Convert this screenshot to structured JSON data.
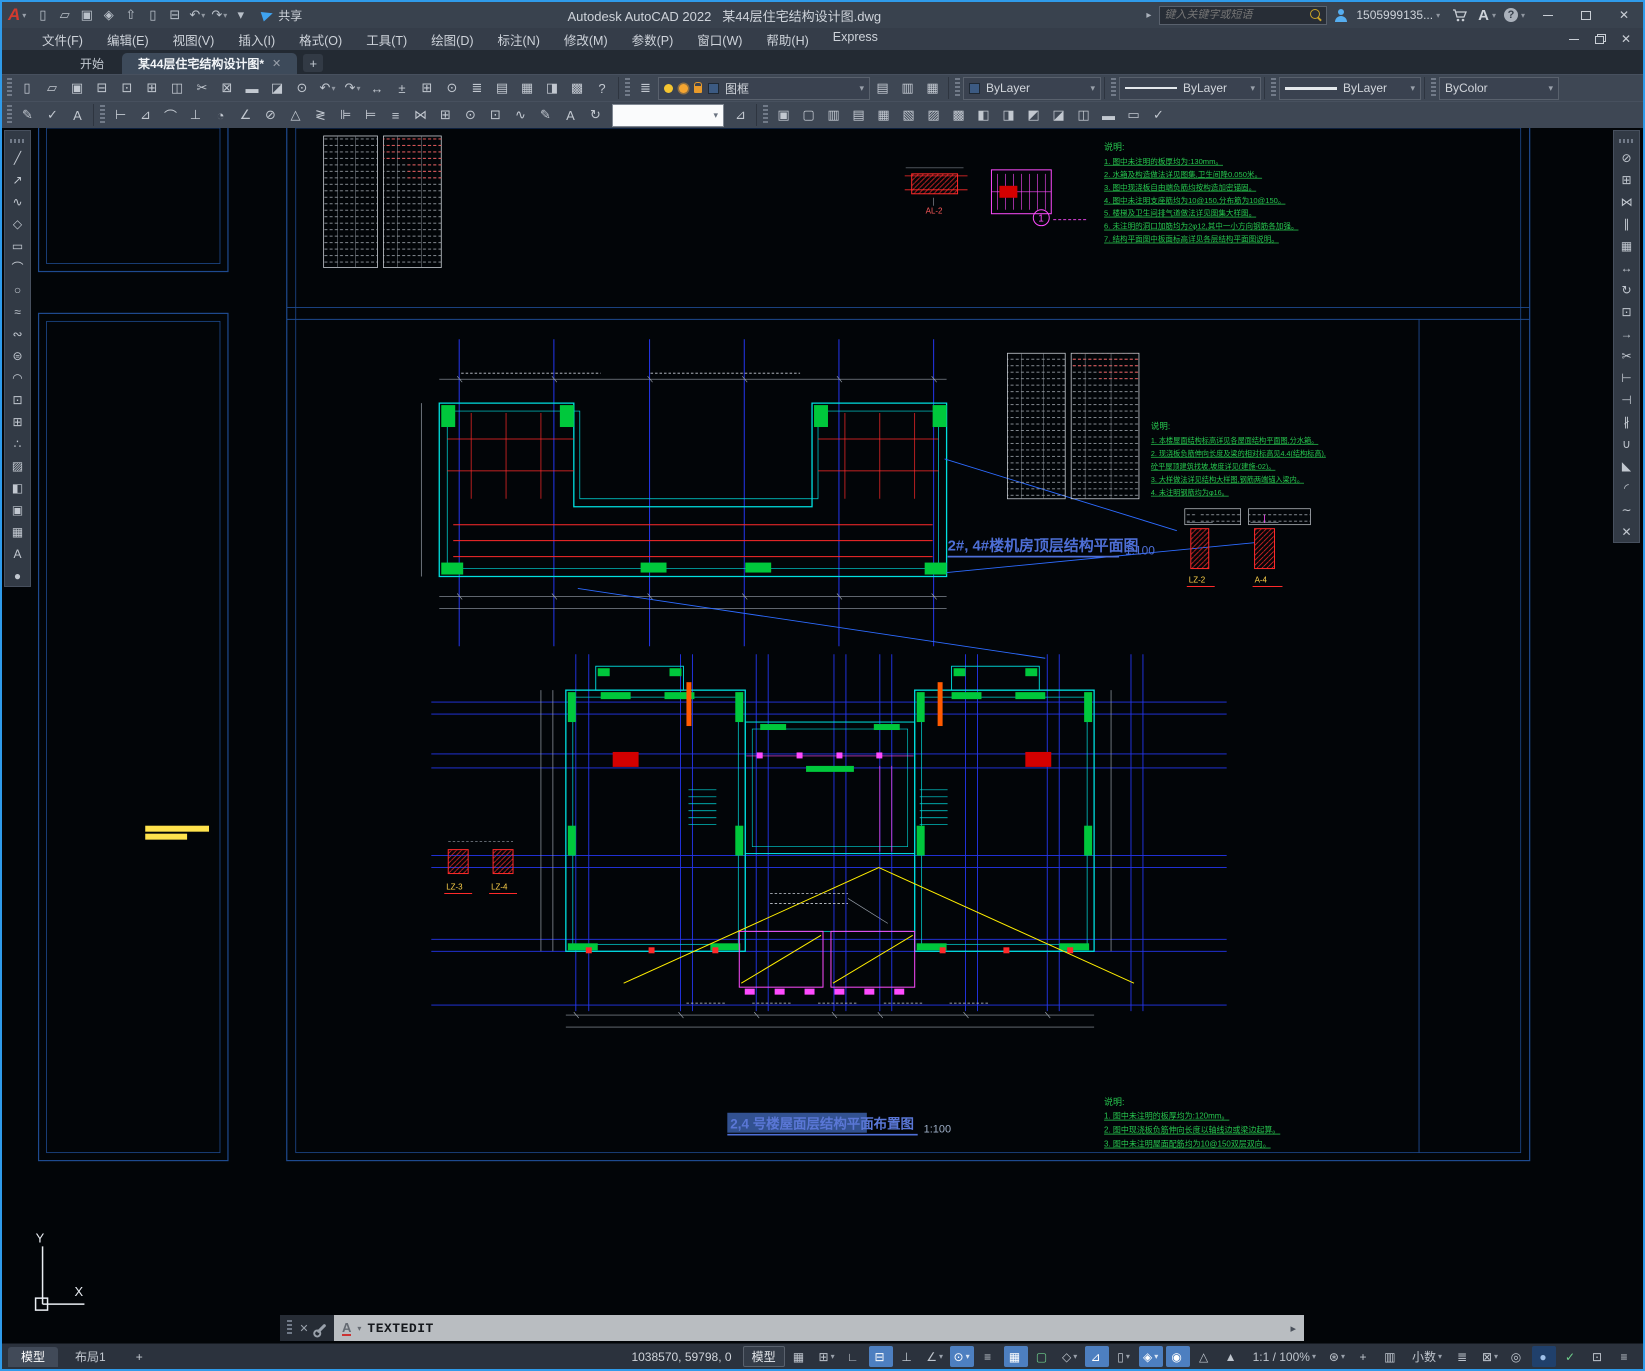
{
  "window": {
    "app_title": "Autodesk AutoCAD 2022",
    "doc_title": "某44层住宅结构设计图.dwg",
    "share_label": "共享",
    "search_placeholder": "键入关键字或短语",
    "account": "1505999135...",
    "start_tab": "开始",
    "doc_tab": "某44层住宅结构设计图*",
    "close_glyph": "✕",
    "new_tab_glyph": "+",
    "collapse_glyph": "▸",
    "help_glyph": "?",
    "autodesk_glyph": "A"
  },
  "menus": [
    {
      "n": "menu-file",
      "l": "文件(F)"
    },
    {
      "n": "menu-edit",
      "l": "编辑(E)"
    },
    {
      "n": "menu-view",
      "l": "视图(V)"
    },
    {
      "n": "menu-insert",
      "l": "插入(I)"
    },
    {
      "n": "menu-format",
      "l": "格式(O)"
    },
    {
      "n": "menu-tools",
      "l": "工具(T)"
    },
    {
      "n": "menu-draw",
      "l": "绘图(D)"
    },
    {
      "n": "menu-dimension",
      "l": "标注(N)"
    },
    {
      "n": "menu-modify",
      "l": "修改(M)"
    },
    {
      "n": "menu-parametric",
      "l": "参数(P)"
    },
    {
      "n": "menu-window",
      "l": "窗口(W)"
    },
    {
      "n": "menu-help",
      "l": "帮助(H)"
    },
    {
      "n": "menu-express",
      "l": "Express"
    }
  ],
  "qat": [
    {
      "n": "qat-new-icon",
      "g": "▯"
    },
    {
      "n": "qat-open-icon",
      "g": "▱"
    },
    {
      "n": "qat-save-icon",
      "g": "▣"
    },
    {
      "n": "qat-save-as-icon",
      "g": "◈"
    },
    {
      "n": "qat-upload-mobile-icon",
      "g": "⇧"
    },
    {
      "n": "qat-open-mobile-icon",
      "g": "▯"
    },
    {
      "n": "qat-plot-icon",
      "g": "⊟"
    },
    {
      "n": "qat-undo-icon",
      "g": "↶",
      "cv": "▾"
    },
    {
      "n": "qat-redo-icon",
      "g": "↷",
      "cv": "▾"
    },
    {
      "n": "qat-customize-icon",
      "g": "▾"
    }
  ],
  "toolbar1": {
    "icons": [
      {
        "n": "new-icon",
        "g": "▯"
      },
      {
        "n": "open-icon",
        "g": "▱"
      },
      {
        "n": "save-icon",
        "g": "▣"
      },
      {
        "n": "plot-icon",
        "g": "⊟"
      },
      {
        "n": "plot-preview-icon",
        "g": "⊡"
      },
      {
        "n": "publish-icon",
        "g": "⊞"
      },
      {
        "n": "batch-plot-icon",
        "g": "◫"
      },
      {
        "n": "cut-icon",
        "g": "✂"
      },
      {
        "n": "copy-clip-icon",
        "g": "⊠"
      },
      {
        "n": "paste-icon",
        "g": "▬"
      },
      {
        "n": "copy-base-point-icon",
        "g": "◪"
      },
      {
        "n": "match-properties-icon",
        "g": "⊙"
      },
      {
        "n": "undo-icon",
        "g": "↶",
        "cv": "▾"
      },
      {
        "n": "redo-icon",
        "g": "↷",
        "cv": "▾"
      },
      {
        "n": "pan-icon",
        "g": "↔"
      },
      {
        "n": "zoom-realtime-icon",
        "g": "±"
      },
      {
        "n": "zoom-window-icon",
        "g": "⊞"
      },
      {
        "n": "zoom-previous-icon",
        "g": "⊙"
      },
      {
        "n": "layer-properties-icon",
        "g": "≣"
      },
      {
        "n": "layer-states-icon",
        "g": "▤"
      },
      {
        "n": "properties-palette-icon",
        "g": "▦"
      },
      {
        "n": "design-center-icon",
        "g": "◨"
      },
      {
        "n": "tool-palettes-icon",
        "g": "▩"
      },
      {
        "n": "help-icon",
        "g": "?"
      }
    ],
    "layer_tools_icon": {
      "n": "layer-manager-icon",
      "g": "≣"
    },
    "layer_value": "图框",
    "layer_state_icons": [
      {
        "n": "make-object-layer-current-icon",
        "g": "▤"
      },
      {
        "n": "layer-previous-icon",
        "g": "▥"
      },
      {
        "n": "layer-translate-icon",
        "g": "▦"
      }
    ],
    "color_value": "ByLayer",
    "linetype_value": "ByLayer",
    "lineweight_value": "ByLayer",
    "plotstyle_value": "ByColor"
  },
  "toolbar2": {
    "text_icons": [
      {
        "n": "edit-text-icon",
        "g": "✎"
      },
      {
        "n": "spell-check-icon",
        "g": "✓"
      },
      {
        "n": "text-style-icon",
        "g": "A"
      }
    ],
    "dim_icons": [
      {
        "n": "dim-linear-icon",
        "g": "⊢"
      },
      {
        "n": "dim-aligned-icon",
        "g": "⊿"
      },
      {
        "n": "dim-arc-length-icon",
        "g": "⌒"
      },
      {
        "n": "dim-ordinate-icon",
        "g": "⊥"
      },
      {
        "n": "dim-radius-icon",
        "g": "◔"
      },
      {
        "n": "dim-angular-icon",
        "g": "∠"
      },
      {
        "n": "dim-diameter-icon",
        "g": "⊘"
      },
      {
        "n": "dim-angular3-icon",
        "g": "△"
      },
      {
        "n": "quick-dimension-icon",
        "g": "≷"
      },
      {
        "n": "dim-baseline-icon",
        "g": "⊫"
      },
      {
        "n": "dim-continue-icon",
        "g": "⊨"
      },
      {
        "n": "dim-spacing-icon",
        "g": "≡"
      },
      {
        "n": "dim-break-icon",
        "g": "⋈"
      },
      {
        "n": "tolerance-icon",
        "g": "⊞"
      },
      {
        "n": "center-mark-icon",
        "g": "⊙"
      },
      {
        "n": "dim-inspect-icon",
        "g": "⊡"
      },
      {
        "n": "dim-jogged-icon",
        "g": "∿"
      },
      {
        "n": "dim-edit-icon",
        "g": "✎"
      },
      {
        "n": "dim-text-edit-icon",
        "g": "A"
      },
      {
        "n": "dim-update-icon",
        "g": "↻"
      }
    ],
    "dimstyle_value": "",
    "solid_icons": [
      {
        "n": "union-icon",
        "g": "▣"
      },
      {
        "n": "subtract-icon",
        "g": "▢"
      },
      {
        "n": "intersect-icon",
        "g": "▥"
      },
      {
        "n": "extrude-faces-icon",
        "g": "▤"
      },
      {
        "n": "move-faces-icon",
        "g": "▦"
      },
      {
        "n": "offset-faces-icon",
        "g": "▧"
      },
      {
        "n": "delete-faces-icon",
        "g": "▨"
      },
      {
        "n": "rotate-faces-icon",
        "g": "▩"
      },
      {
        "n": "taper-faces-icon",
        "g": "◧"
      },
      {
        "n": "copy-faces-icon",
        "g": "◨"
      },
      {
        "n": "color-faces-icon",
        "g": "◩"
      },
      {
        "n": "imprint-icon",
        "g": "◪"
      },
      {
        "n": "clean-icon",
        "g": "◫"
      },
      {
        "n": "separate-icon",
        "g": "▬"
      },
      {
        "n": "shell-icon",
        "g": "▭"
      },
      {
        "n": "check-icon",
        "g": "✓"
      }
    ]
  },
  "draw_toolbar": [
    {
      "n": "line-icon",
      "g": "╱"
    },
    {
      "n": "construction-line-icon",
      "g": "↗"
    },
    {
      "n": "polyline-icon",
      "g": "∿"
    },
    {
      "n": "polygon-icon",
      "g": "◇"
    },
    {
      "n": "rectangle-icon",
      "g": "▭"
    },
    {
      "n": "arc-icon",
      "g": "⌒"
    },
    {
      "n": "circle-icon",
      "g": "○"
    },
    {
      "n": "revision-cloud-icon",
      "g": "≈"
    },
    {
      "n": "spline-icon",
      "g": "∾"
    },
    {
      "n": "ellipse-icon",
      "g": "⊜"
    },
    {
      "n": "ellipse-arc-icon",
      "g": "◠"
    },
    {
      "n": "insert-block-icon",
      "g": "⊡"
    },
    {
      "n": "make-block-icon",
      "g": "⊞"
    },
    {
      "n": "point-icon",
      "g": "∴"
    },
    {
      "n": "hatch-icon",
      "g": "▨"
    },
    {
      "n": "gradient-icon",
      "g": "◧"
    },
    {
      "n": "region-icon",
      "g": "▣"
    },
    {
      "n": "table-icon",
      "g": "▦"
    },
    {
      "n": "multiline-text-icon",
      "g": "A"
    },
    {
      "n": "point-style-icon",
      "g": "●"
    }
  ],
  "modify_toolbar": [
    {
      "n": "erase-icon",
      "g": "⊘"
    },
    {
      "n": "copy-icon",
      "g": "⊞"
    },
    {
      "n": "mirror-icon",
      "g": "⋈"
    },
    {
      "n": "offset-icon",
      "g": "∥"
    },
    {
      "n": "array-icon",
      "g": "▦"
    },
    {
      "n": "move-icon",
      "g": "↔"
    },
    {
      "n": "rotate-icon",
      "g": "↻"
    },
    {
      "n": "scale-icon",
      "g": "⊡"
    },
    {
      "n": "stretch-icon",
      "g": "→"
    },
    {
      "n": "trim-icon",
      "g": "✂"
    },
    {
      "n": "extend-icon",
      "g": "⊢"
    },
    {
      "n": "break-at-point-icon",
      "g": "⊣"
    },
    {
      "n": "break-icon",
      "g": "∦"
    },
    {
      "n": "join-icon",
      "g": "∪"
    },
    {
      "n": "chamfer-icon",
      "g": "◣"
    },
    {
      "n": "fillet-icon",
      "g": "◜"
    },
    {
      "n": "blend-curves-icon",
      "g": "∼"
    },
    {
      "n": "explode-icon",
      "g": "✕"
    }
  ],
  "drawing": {
    "title1": "2#, 4#楼机房顶层结构平面图",
    "title1_scale": "1:100",
    "title2": "2,4 号楼屋面层结构平面布置图",
    "title2_scale": "1:100",
    "labels": {
      "al2": "AL-2",
      "lz2": "LZ-2",
      "a4": "A-4",
      "lz3": "LZ-3",
      "lz4": "LZ-4",
      "mark1": "1"
    },
    "ucs": {
      "x_label": "X",
      "y_label": "Y"
    },
    "notes_top": {
      "title": "说明:",
      "lines": [
        "1. 图中未注明的板厚均为:130mm。",
        "2. 水箱及构造做法详见图集,卫生间降0.050米。",
        "3. 图中现浇板自由端负筋均按构造加密锚固。",
        "4. 图中未注明支座筋均为10@150,分布筋为10@150。",
        "5. 楼梯及卫生间排气道做法详见图集大样图。",
        "6. 未注明的洞口加筋均为2φ12,其中一小方向钢筋各加强。",
        "7. 结构平面图中板面标高详见各层结构平面图说明。"
      ]
    },
    "notes_mid": {
      "title": "说明:",
      "lines": [
        "1. 本楼屋面结构标高详见各屋面结构平面图,分水箱。",
        "2. 现浇板负筋伸向长度及梁的相对标高见4.4(结构标高),",
        "   砼平屋顶建筑找坡,坡度详见(建施-02)。",
        "3. 大样做法详见结构大样图,钢筋两端锚入梁内。",
        "4. 未注明钢筋均为φ16。"
      ]
    },
    "notes_bottom": {
      "title": "说明:",
      "lines": [
        "1. 图中未注明的板厚均为:120mm。",
        "2. 图中现浇板负筋伸向长度以轴线边或梁边起算。",
        "3. 图中未注明屋面配筋均为10@150双层双向。"
      ]
    }
  },
  "command": {
    "label": "TEXTEDIT"
  },
  "statusbar": {
    "model_tab": "模型",
    "layout_tab": "布局1",
    "new_layout": "+",
    "coords": "1038570, 59798, 0",
    "model_button": "模型",
    "icons": [
      {
        "n": "grid-display-icon",
        "g": "▦"
      },
      {
        "n": "snap-mode-icon",
        "g": "⊞",
        "cv": "▾"
      },
      {
        "n": "infer-constraints-icon",
        "g": "∟"
      },
      {
        "n": "dynamic-input-icon",
        "g": "⊟",
        "cls": "on"
      },
      {
        "n": "ortho-mode-icon",
        "g": "⊥"
      },
      {
        "n": "polar-tracking-icon",
        "g": "∠",
        "cv": "▾"
      },
      {
        "n": "object-snap-icon",
        "g": "⊙",
        "cv": "▾",
        "cls": "on"
      },
      {
        "n": "lineweight-display-icon",
        "g": "≡"
      },
      {
        "n": "transparency-icon",
        "g": "▦",
        "cls": "on"
      },
      {
        "n": "selection-cycling-icon",
        "g": "▢",
        "cls": "green"
      },
      {
        "n": "osnap-3d-icon",
        "g": "◇",
        "cv": "▾"
      },
      {
        "n": "dynamic-ucs-icon",
        "g": "⊿",
        "cls": "on"
      },
      {
        "n": "selection-filter-icon",
        "g": "▯",
        "cv": "▾"
      },
      {
        "n": "gizmo-icon",
        "g": "◈",
        "cv": "▾",
        "cls": "on"
      },
      {
        "n": "annotation-visibility-icon",
        "g": "◉",
        "cls": "on"
      },
      {
        "n": "annotation-autoscale-icon",
        "g": "△"
      },
      {
        "n": "annotation-scale-icon",
        "g": "▲"
      },
      {
        "n": "viewport-scale-button",
        "g": "1:1 / 100%",
        "cv": "▾",
        "cls": "txt"
      },
      {
        "n": "workspace-switching-icon",
        "g": "⊛",
        "cv": "▾"
      },
      {
        "n": "annotation-monitor-icon",
        "g": "+"
      },
      {
        "n": "units-ruler-icon",
        "g": "▥"
      },
      {
        "n": "units-button",
        "g": "小数",
        "cv": "▾",
        "cls": "txt"
      },
      {
        "n": "quick-properties-icon",
        "g": "≣"
      },
      {
        "n": "lock-ui-icon",
        "g": "⊠",
        "cv": "▾"
      },
      {
        "n": "isolate-objects-icon",
        "g": "◎"
      },
      {
        "n": "graphics-performance-icon",
        "g": "●",
        "cls": "darkon"
      },
      {
        "n": "import-status-icon",
        "g": "✓",
        "cls": "green"
      },
      {
        "n": "clean-screen-icon",
        "g": "⊡"
      },
      {
        "n": "customize-statusbar-icon",
        "g": "≡"
      }
    ]
  }
}
